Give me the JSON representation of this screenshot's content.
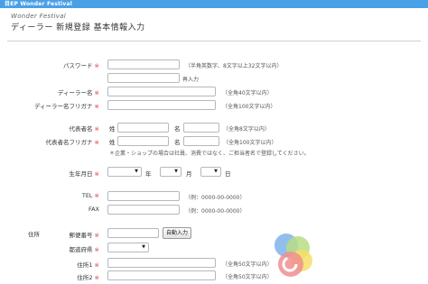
{
  "header": {
    "logo": "目EP Wonder Festival"
  },
  "page": {
    "subtitle": "Wonder Festival",
    "title": "ディーラー 新規登録 基本情報入力"
  },
  "required_mark": "※",
  "form": {
    "password": {
      "label": "パスワード",
      "note": "（半角英数字、8文字以上32文字以内）",
      "confirm_note": "再入力"
    },
    "dealer_name": {
      "label": "ディーラー名",
      "note": "（全角40文字以内）"
    },
    "dealer_kana": {
      "label": "ディーラー名フリガナ",
      "note": "（全角100文字以内）"
    },
    "rep_name": {
      "label": "代表者名",
      "sei": "姓",
      "mei": "名",
      "note": "（全角8文字以内）"
    },
    "rep_kana": {
      "label": "代表者名フリガナ",
      "sei": "姓",
      "mei": "名",
      "note": "（全角100文字以内）"
    },
    "company_note": "＊企業・ショップの場合は社員、消費ではなく、ご担当者名で登録してください。",
    "birthdate": {
      "label": "生年月日",
      "year": "年",
      "month": "月",
      "day": "日"
    },
    "tel": {
      "label": "TEL",
      "note": "（例：0000-00-0000）"
    },
    "fax": {
      "label": "FAX",
      "note": "（例：0000-00-0000）"
    },
    "address": {
      "section_label": "住所",
      "postal": {
        "label": "郵便番号",
        "button": "自動入力"
      },
      "prefecture": {
        "label": "都道府県"
      },
      "address1": {
        "label": "住所1",
        "note": "（全角50文字以内）"
      },
      "address2": {
        "label": "住所2",
        "note": "（全角50文字以内）"
      }
    }
  },
  "colors": {
    "header_bg": "#4aa0e6",
    "required": "#e0393e"
  }
}
